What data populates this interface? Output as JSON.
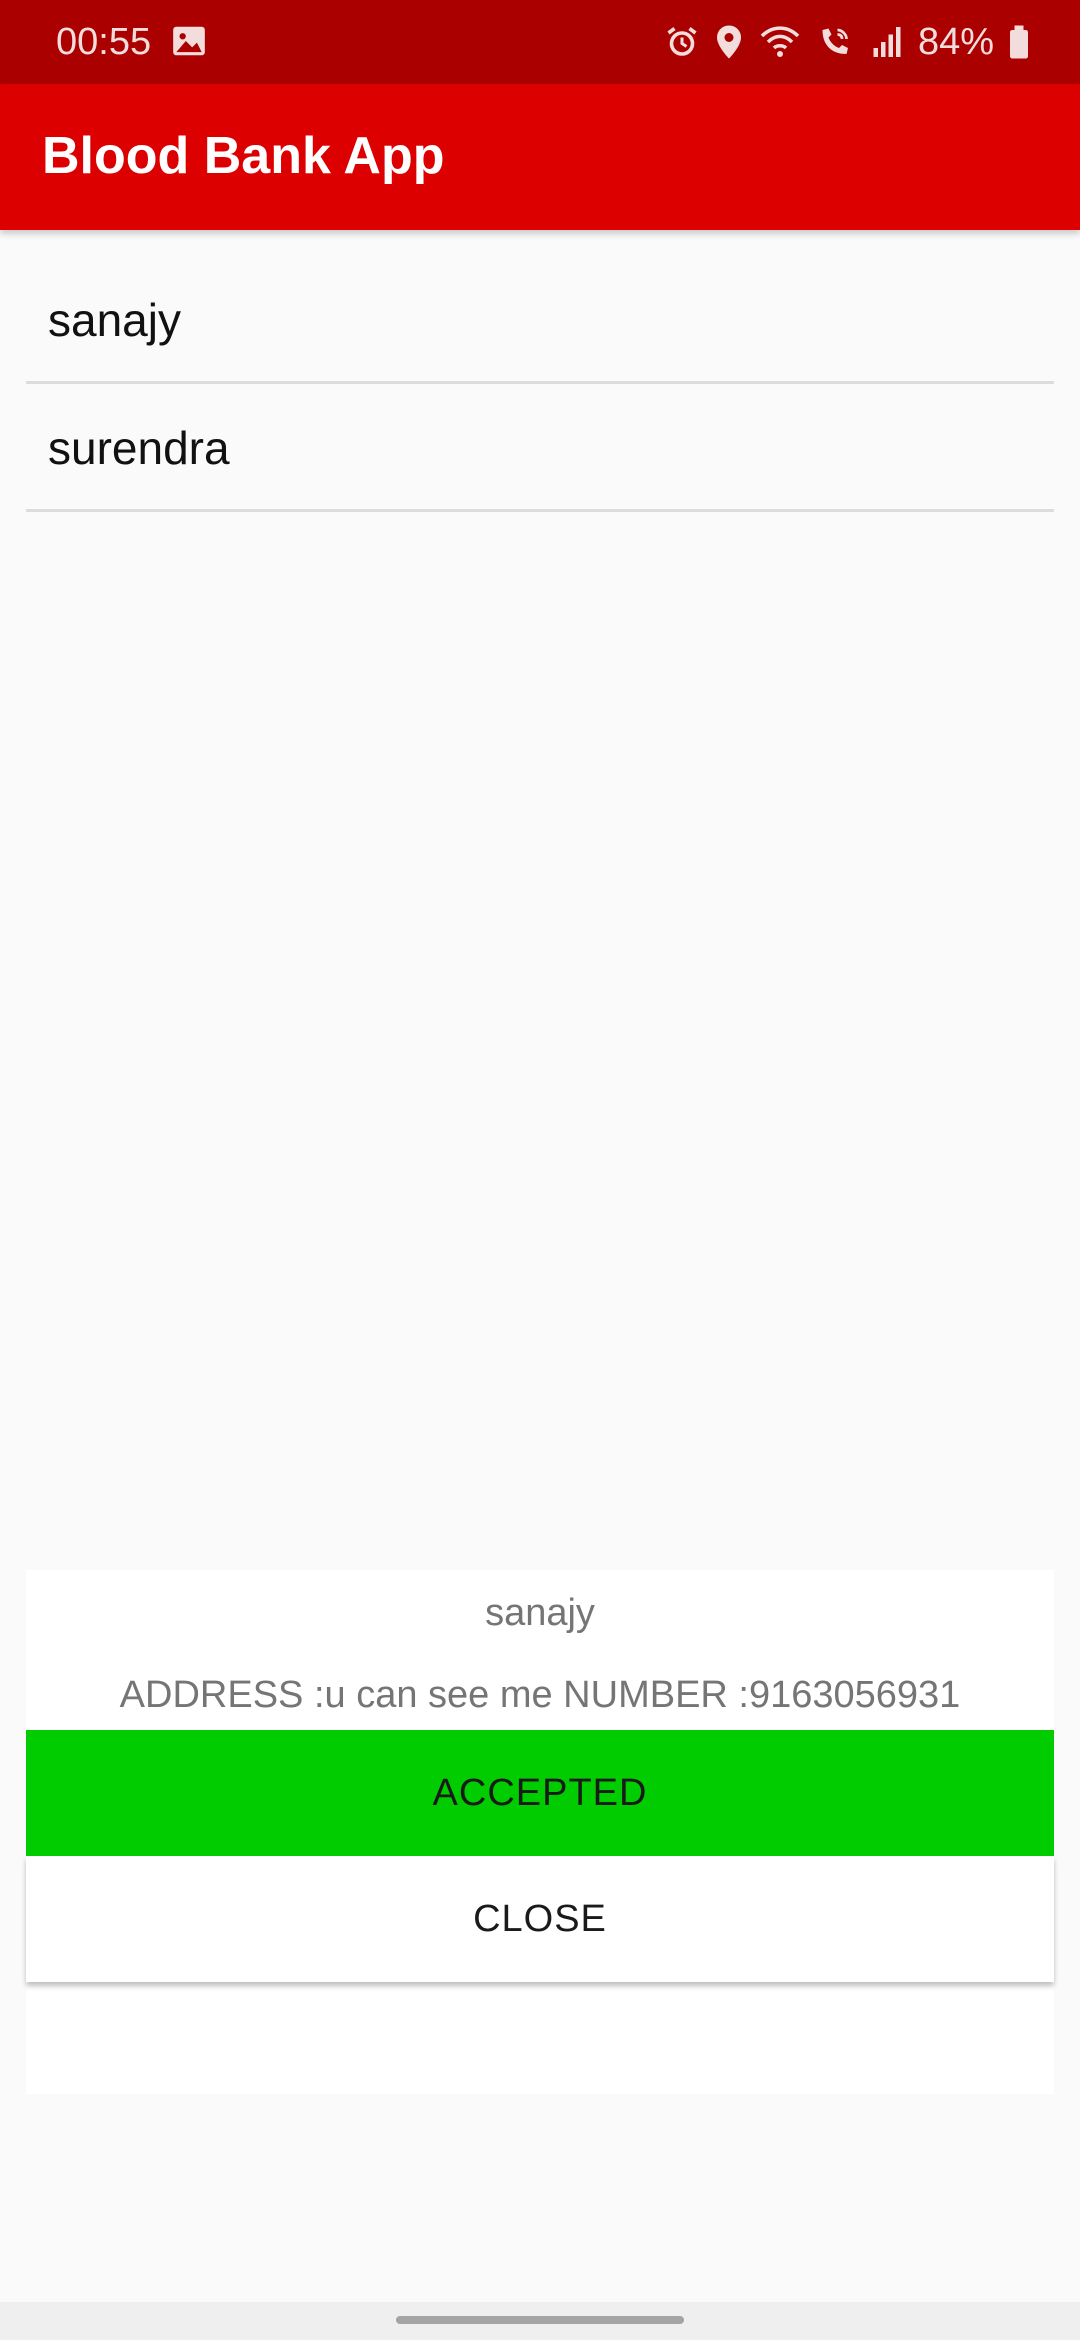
{
  "status_bar": {
    "time": "00:55",
    "battery_percent": "84%",
    "icons": [
      "image-icon",
      "alarm-icon",
      "location-icon",
      "wifi-icon",
      "wifi-calling-icon",
      "signal-icon",
      "battery-icon"
    ]
  },
  "app_bar": {
    "title": "Blood Bank App"
  },
  "donor_list": [
    {
      "name": "sanajy"
    },
    {
      "name": "surendra"
    }
  ],
  "dialog": {
    "title": "sanajy",
    "message": "ADDRESS :u can see me NUMBER :9163056931",
    "accept_label": "ACCEPTED",
    "close_label": "CLOSE"
  },
  "colors": {
    "status_bar": "#aa0000",
    "app_bar": "#dd0000",
    "accept_button": "#00cc00"
  }
}
